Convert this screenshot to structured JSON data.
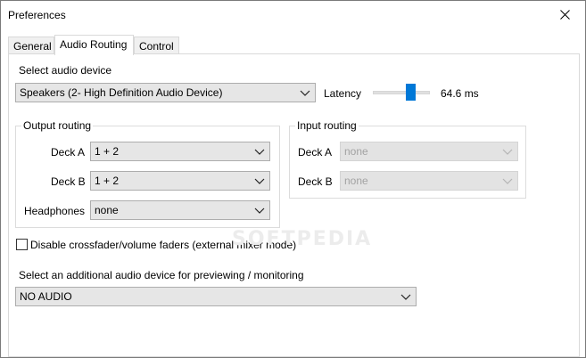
{
  "window": {
    "title": "Preferences"
  },
  "tabs": [
    {
      "label": "General",
      "active": false
    },
    {
      "label": "Audio Routing",
      "active": true
    },
    {
      "label": "Control",
      "active": false
    }
  ],
  "audio_device": {
    "label": "Select audio device",
    "selected": "Speakers (2- High Definition Audio Device)"
  },
  "latency": {
    "label": "Latency",
    "value_text": "64.6 ms",
    "slider_fraction": 0.67
  },
  "output_routing": {
    "title": "Output routing",
    "rows": [
      {
        "label": "Deck A",
        "value": "1 + 2"
      },
      {
        "label": "Deck B",
        "value": "1 + 2"
      },
      {
        "label": "Headphones",
        "value": "none"
      }
    ]
  },
  "input_routing": {
    "title": "Input routing",
    "rows": [
      {
        "label": "Deck A",
        "value": "none"
      },
      {
        "label": "Deck B",
        "value": "none"
      }
    ]
  },
  "crossfader": {
    "label": "Disable crossfader/volume faders (external mixer mode)",
    "checked": false
  },
  "monitor_device": {
    "label": "Select an additional audio device for previewing / monitoring",
    "selected": "NO AUDIO"
  },
  "watermark": "SOFTPEDIA",
  "colors": {
    "accent": "#0078d7",
    "combo_bg": "#e6e6e6",
    "disabled_text": "#a3a3a3"
  },
  "icons": {
    "close": "close-icon",
    "dropdown": "chevron-down-icon"
  }
}
